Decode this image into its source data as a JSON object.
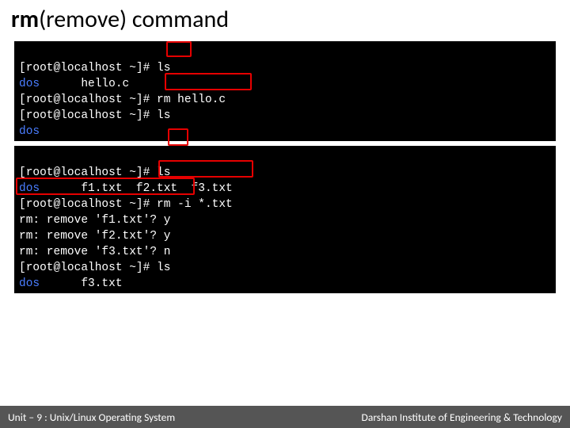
{
  "title": {
    "bold": "rm",
    "rest": "(remove) command"
  },
  "term1": {
    "l1_prefix": "[root@localhost ~]# ",
    "l1_cmd": "ls",
    "l2_pre": "dos",
    "l2_rest": "      hello.c",
    "l3_prefix": "[root@localhost ~]# ",
    "l3_cmd": "rm hello.c",
    "l4_prefix": "[root@localhost ~]# ",
    "l4_cmd": "ls",
    "l5": "dos"
  },
  "term2": {
    "l1_prefix": "[root@localhost ~]# ",
    "l1_cmd": "ls",
    "l2_pre": "dos",
    "l2_rest": "      f1.txt  f2.txt  f3.txt",
    "l3_prefix": "[root@localhost ~]# ",
    "l3_cmd": "rm -i *.txt",
    "l4": "rm: remove 'f1.txt'? y",
    "l5": "rm: remove 'f2.txt'? y",
    "l6": "rm: remove 'f3.txt'? n",
    "l7_prefix": "[root@localhost ~]# ",
    "l7_cmd": "ls",
    "l8_pre": "dos",
    "l8_rest": "      f3.txt"
  },
  "footer": {
    "left": "Unit – 9 : Unix/Linux Operating System",
    "right": "Darshan Institute of Engineering & Technology"
  }
}
